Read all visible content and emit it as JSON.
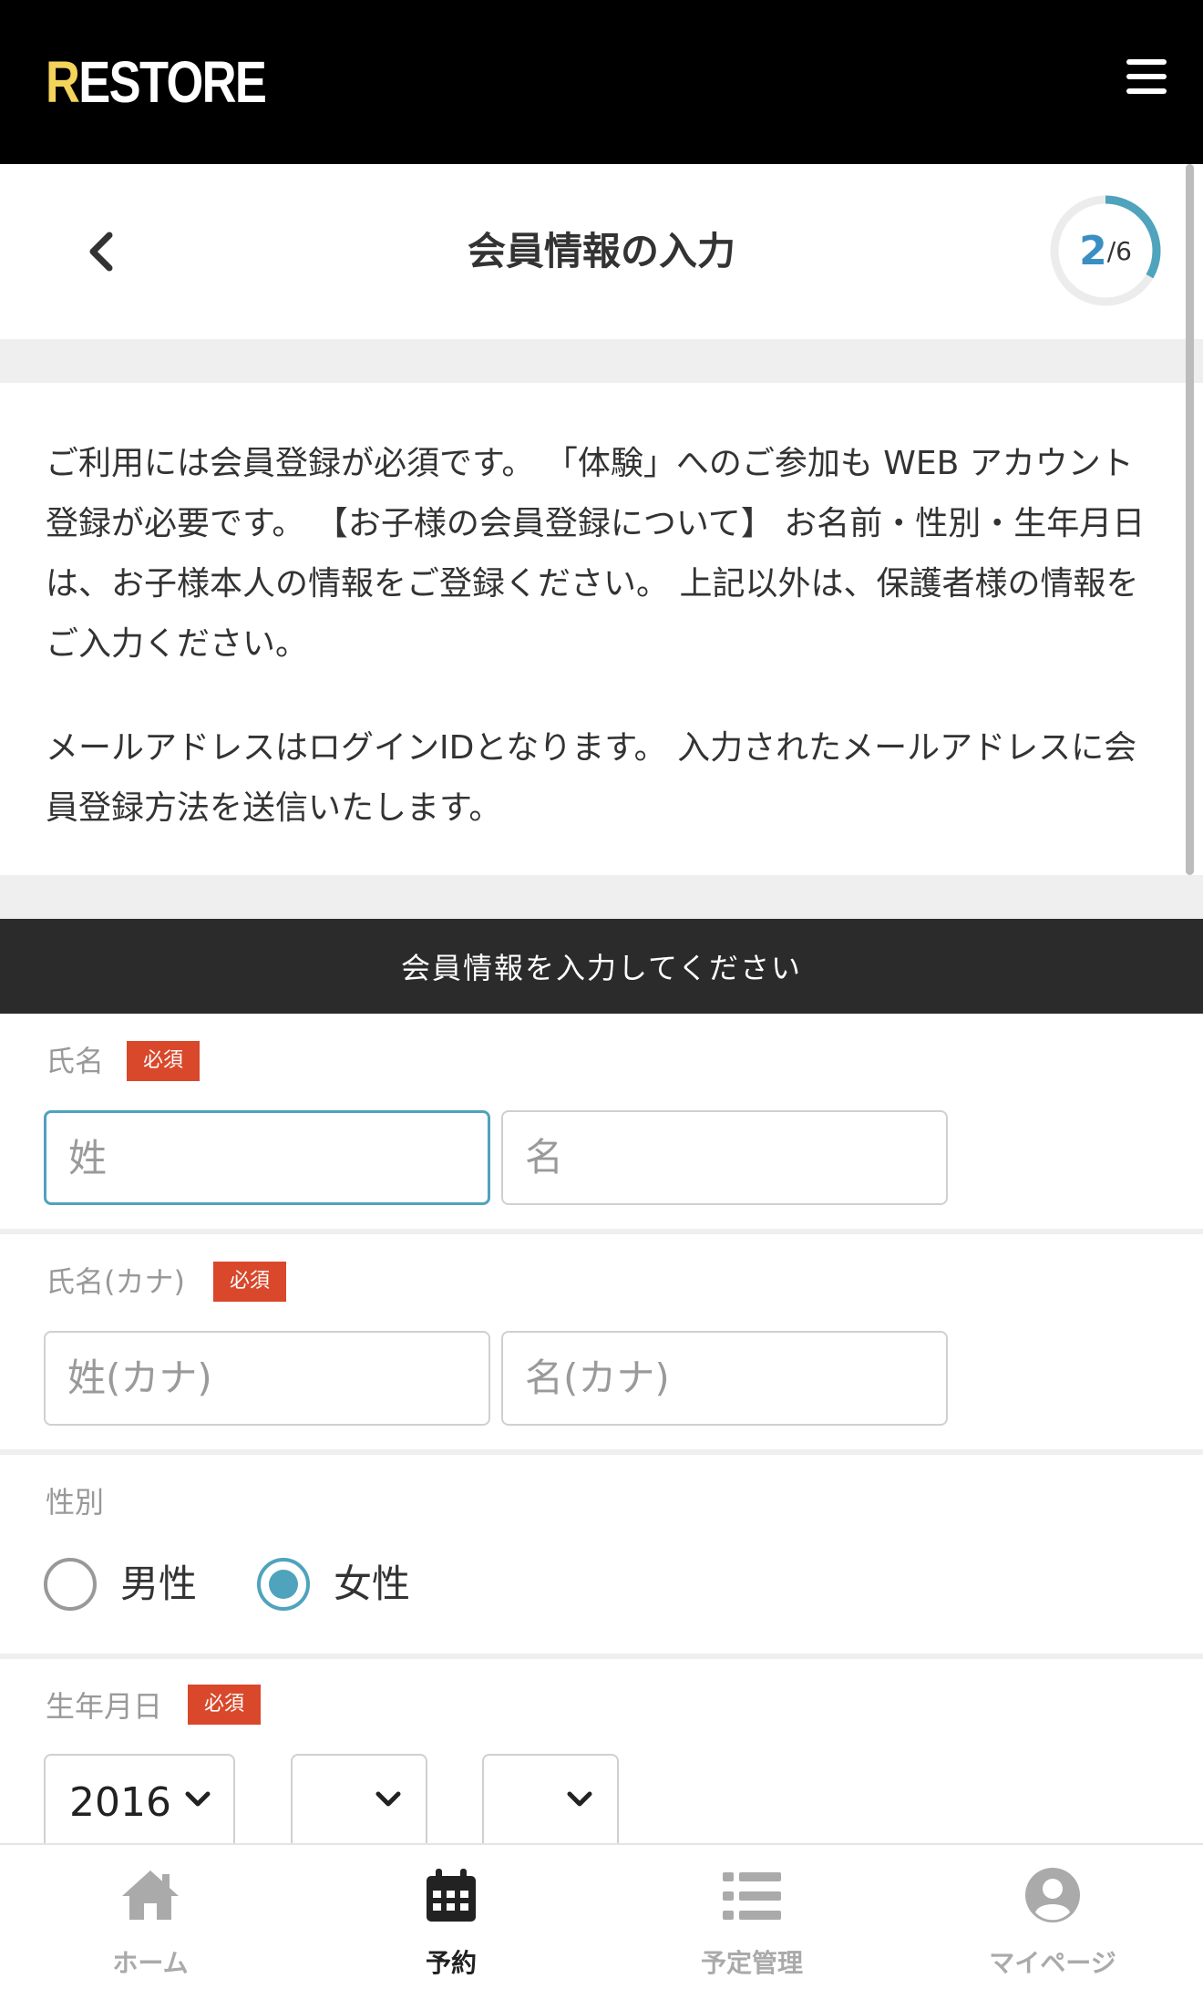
{
  "appbar": {
    "logo_first": "R",
    "logo_rest": "ESTORE",
    "menu_icon": "hamburger-menu-icon"
  },
  "header": {
    "title": "会員情報の入力",
    "step_current": "2",
    "step_total": "/6",
    "progress_fraction": 0.3333,
    "back_icon": "chevron-left-icon"
  },
  "info": {
    "paragraph1": "ご利用には会員登録が必須です。 「体験」へのご参加も WEB アカウント登録が必要です。 【お子様の会員登録について】 お名前・性別・生年月日は、お子様本人の情報をご登録ください。 上記以外は、保護者様の情報をご入力ください。",
    "paragraph2": "メールアドレスはログインIDとなります。 入力されたメールアドレスに会員登録方法を送信いたします。"
  },
  "section": {
    "title": "会員情報を入力してください"
  },
  "form": {
    "required_badge": "必須",
    "name": {
      "label": "氏名",
      "last_placeholder": "姓",
      "first_placeholder": "名"
    },
    "kana": {
      "label": "氏名(カナ)",
      "last_placeholder": "姓(カナ)",
      "first_placeholder": "名(カナ)"
    },
    "gender": {
      "label": "性別",
      "options": [
        "男性",
        "女性"
      ],
      "selected": "女性"
    },
    "birthday": {
      "label": "生年月日",
      "year_value": "2016",
      "month_value": "",
      "day_value": ""
    }
  },
  "nav": {
    "items": [
      {
        "label": "ホーム",
        "icon": "home-icon",
        "active": false
      },
      {
        "label": "予約",
        "icon": "calendar-icon",
        "active": true
      },
      {
        "label": "予定管理",
        "icon": "list-icon",
        "active": false
      },
      {
        "label": "マイページ",
        "icon": "user-circle-icon",
        "active": false
      }
    ]
  },
  "colors": {
    "accent": "#4fa3bd",
    "badge": "#d9482b",
    "logo_r": "#f3d35a",
    "band": "#2b2b2b"
  }
}
